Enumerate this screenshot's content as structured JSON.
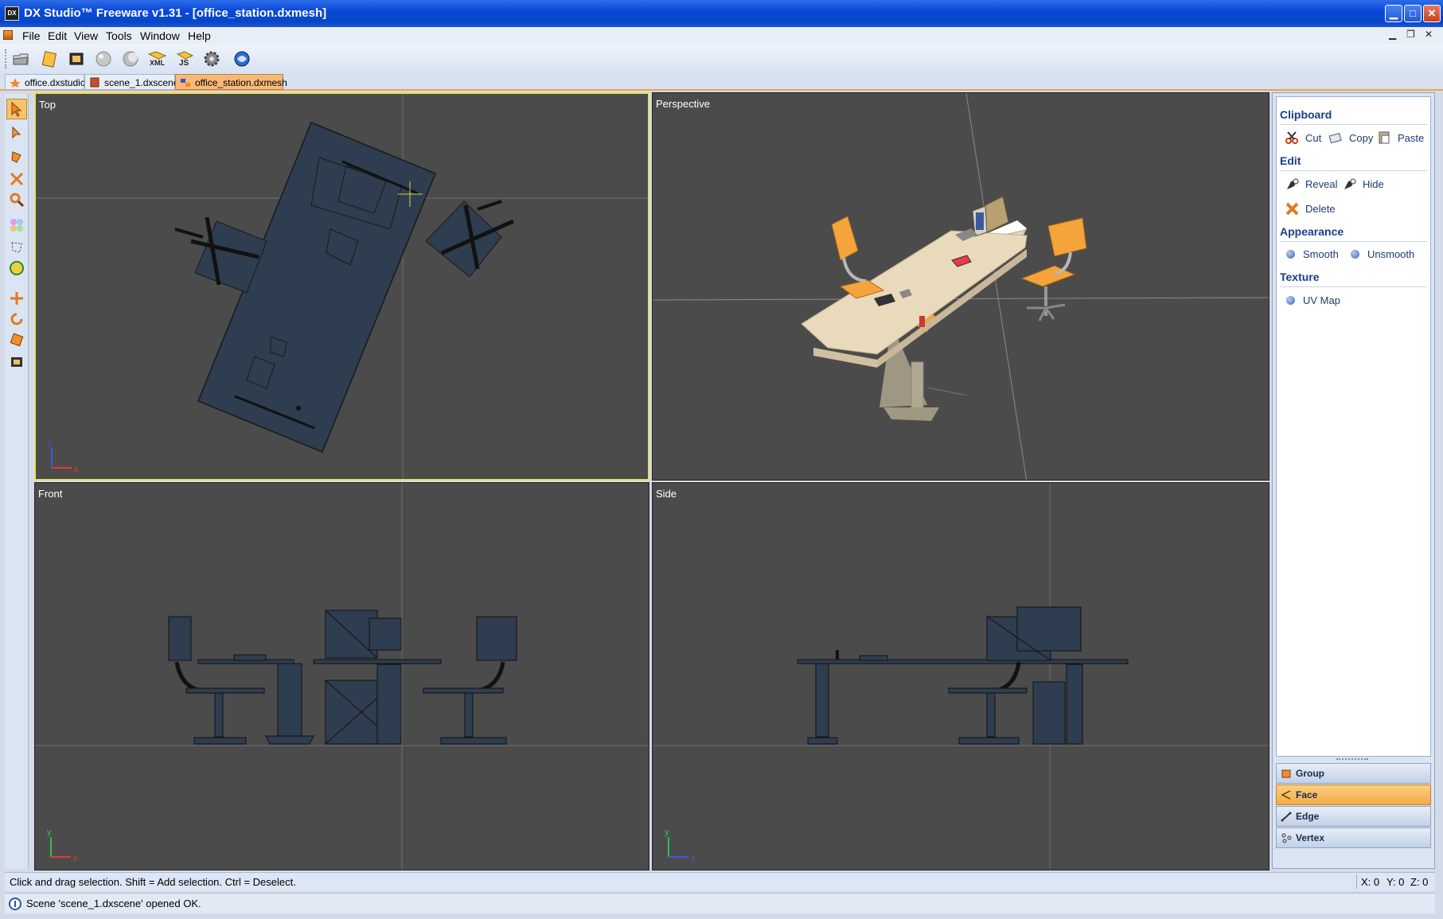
{
  "window": {
    "title": "DX Studio™ Freeware v1.31 - [office_station.dxmesh]",
    "app_icon": "DX"
  },
  "menu": [
    "File",
    "Edit",
    "View",
    "Tools",
    "Window",
    "Help"
  ],
  "toolbar": {
    "icons": [
      "open-icon",
      "new-icon",
      "film-icon",
      "sphere-icon",
      "moon-icon",
      "xml-icon",
      "js-icon",
      "gear-icon",
      "globe-icon"
    ],
    "xml_label": "XML",
    "js_label": "JS"
  },
  "tabs": [
    {
      "label": "office.dxstudio",
      "active": false
    },
    {
      "label": "scene_1.dxscene",
      "active": false
    },
    {
      "label": "office_station.dxmesh",
      "active": true
    }
  ],
  "viewports": {
    "top": {
      "label": "Top",
      "axis1": "z",
      "axis2": "x"
    },
    "perspective": {
      "label": "Perspective"
    },
    "front": {
      "label": "Front",
      "axis1": "y",
      "axis2": "x"
    },
    "side": {
      "label": "Side",
      "axis1": "y",
      "axis2": "z"
    }
  },
  "panel": {
    "clipboard": {
      "title": "Clipboard",
      "cut": "Cut",
      "copy": "Copy",
      "paste": "Paste"
    },
    "edit": {
      "title": "Edit",
      "reveal": "Reveal",
      "hide": "Hide",
      "delete": "Delete"
    },
    "appearance": {
      "title": "Appearance",
      "smooth": "Smooth",
      "unsmooth": "Unsmooth"
    },
    "texture": {
      "title": "Texture",
      "uvmap": "UV Map"
    },
    "modes": [
      {
        "label": "Group",
        "active": false
      },
      {
        "label": "Face",
        "active": true
      },
      {
        "label": "Edge",
        "active": false
      },
      {
        "label": "Vertex",
        "active": false
      }
    ]
  },
  "status": {
    "hint": "Click and drag selection. Shift = Add selection. Ctrl = Deselect.",
    "x": "X: 0",
    "y": "Y: 0",
    "z": "Z: 0",
    "message": "Scene 'scene_1.dxscene' opened OK."
  },
  "colors": {
    "accent": "#f4a848",
    "viewport_bg": "#4b4b4b",
    "mesh": "#2e3d4f",
    "active_border": "#e8e060"
  }
}
